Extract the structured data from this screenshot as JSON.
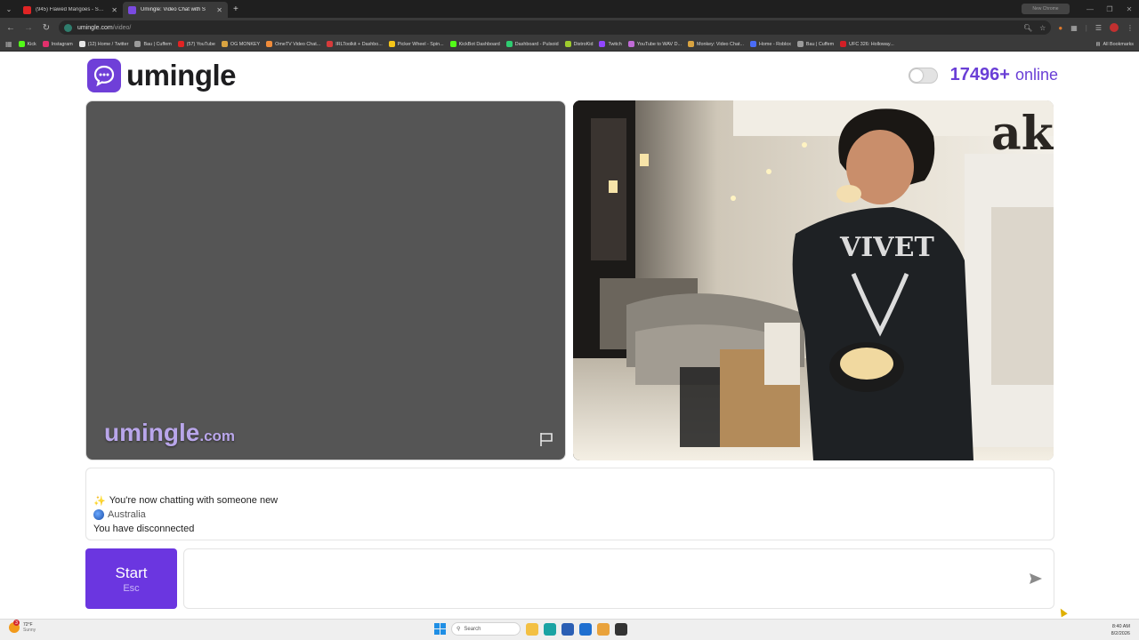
{
  "browser": {
    "tabs": [
      {
        "title": "(945) Flawed Mangoes - Swimm",
        "favicon_color": "#e02424",
        "active": false
      },
      {
        "title": "Umingle: Video Chat with S",
        "favicon_color": "#7a4ae0",
        "active": true
      }
    ],
    "profile_label": "New Chrome",
    "address": {
      "host": "umingle.com",
      "path": "/video/"
    },
    "bookmarks": [
      {
        "label": "Kick",
        "color": "#53fc18"
      },
      {
        "label": "Instagram",
        "color": "#e1306c"
      },
      {
        "label": "(12) Home / Twitter",
        "color": "#e8e8e8"
      },
      {
        "label": "Bau | Cuffem",
        "color": "#9b9b9b"
      },
      {
        "label": "(57) YouTube",
        "color": "#e02424"
      },
      {
        "label": "OG MONKEY",
        "color": "#d9a441"
      },
      {
        "label": "OmeTV Video Chat...",
        "color": "#f08c3a"
      },
      {
        "label": "IRLToolkit + Dashbo...",
        "color": "#d63b3b"
      },
      {
        "label": "Picker Wheel - Spin...",
        "color": "#f5c518"
      },
      {
        "label": "KickBot Dashboard",
        "color": "#53fc18"
      },
      {
        "label": "Dashboard - Pulsoid",
        "color": "#2ecc71"
      },
      {
        "label": "DistroKid",
        "color": "#9ecb2d"
      },
      {
        "label": "Twitch",
        "color": "#9146ff"
      },
      {
        "label": "YouTube to WAV D...",
        "color": "#c06bd6"
      },
      {
        "label": "Monkey: Video Chat...",
        "color": "#d9a441"
      },
      {
        "label": "Home - Roblox",
        "color": "#4a6cf7"
      },
      {
        "label": "Bau | Cuffem",
        "color": "#9b9b9b"
      },
      {
        "label": "UFC 326: Holloway...",
        "color": "#d21f26"
      }
    ],
    "all_bookmarks_label": "All Bookmarks"
  },
  "site": {
    "logo_text": "umingle",
    "brand_color": "#6b36e0",
    "online_count": "17496+",
    "online_label": "online",
    "watermark_main": "umingle",
    "watermark_domain": ".com"
  },
  "chat": {
    "messages": {
      "new_chat": "You're now chatting with someone new",
      "country": "Australia",
      "disconnected": "You have disconnected"
    },
    "start_label": "Start",
    "start_key": "Esc",
    "input_placeholder": ""
  },
  "taskbar": {
    "weather_temp": "72°F",
    "weather_desc": "Sunny",
    "weather_badge": "3",
    "search_label": "Search",
    "time": "8:40 AM",
    "date": "8/2/2026",
    "apps": [
      {
        "name": "file-explorer",
        "color": "#f3c043"
      },
      {
        "name": "edge",
        "color": "#1aa3a3"
      },
      {
        "name": "store",
        "color": "#2b5fb4"
      },
      {
        "name": "mail",
        "color": "#1f6fd0"
      },
      {
        "name": "chrome",
        "color": "#e9a23b"
      },
      {
        "name": "obs",
        "color": "#333333"
      }
    ]
  }
}
